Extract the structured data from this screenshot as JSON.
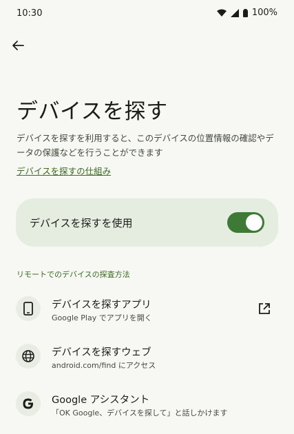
{
  "status": {
    "time": "10:30",
    "battery": "100%"
  },
  "page": {
    "title": "デバイスを探す",
    "description": "デバイスを探すを利用すると、このデバイスの位置情報の確認やデータの保護などを行うことができます",
    "learn_link": "デバイスを探すの仕組み"
  },
  "toggle": {
    "label": "デバイスを探すを使用",
    "state": "on"
  },
  "remote_section": {
    "header": "リモートでのデバイスの探査方法",
    "items": [
      {
        "title": "デバイスを探すアプリ",
        "subtitle": "Google Play でアプリを開く",
        "icon": "phone-icon"
      },
      {
        "title": "デバイスを探すウェブ",
        "subtitle": "android.com/find にアクセス",
        "icon": "globe-icon"
      },
      {
        "title": "Google アシスタント",
        "subtitle": "「OK Google、デバイスを探して」と話しかけます",
        "icon": "google-g-icon"
      }
    ]
  },
  "colors": {
    "background": "#f7f8f3",
    "accent": "#386a20",
    "toggle_on": "#3e7a36",
    "card": "#e5ede0"
  }
}
